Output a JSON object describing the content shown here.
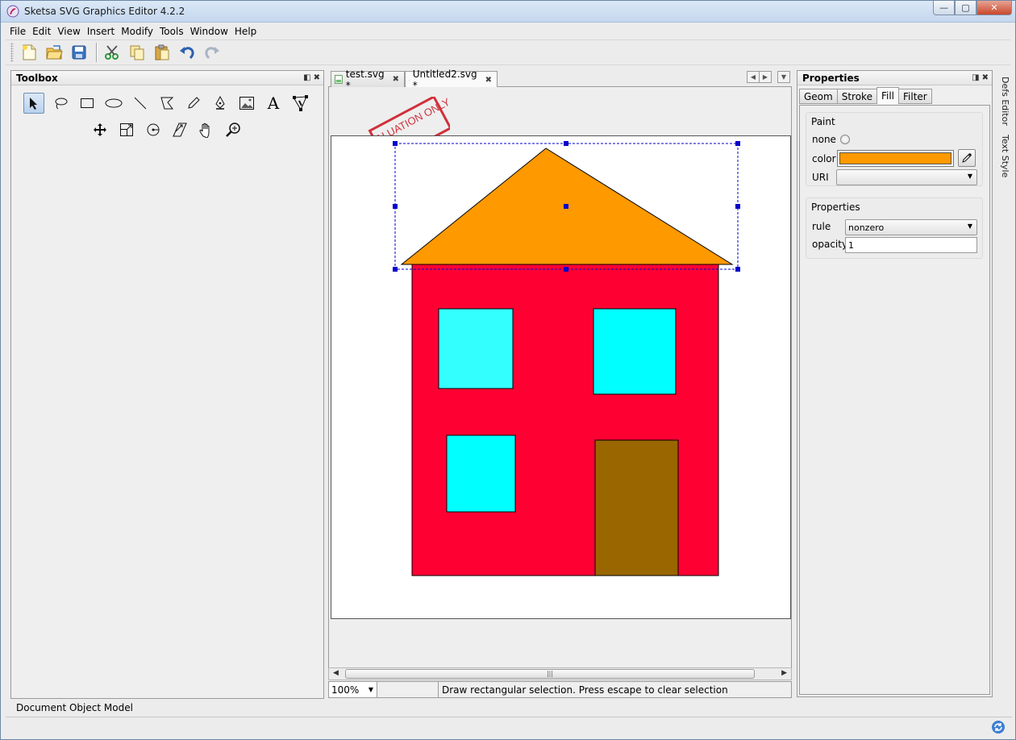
{
  "window": {
    "title": "Sketsa SVG Graphics Editor 4.2.2",
    "controls": {
      "minimize": "—",
      "maximize": "▢",
      "close": "✕"
    }
  },
  "menu": [
    "File",
    "Edit",
    "View",
    "Insert",
    "Modify",
    "Tools",
    "Window",
    "Help"
  ],
  "toolbar": {
    "buttons": [
      "new-file-icon",
      "open-folder-icon",
      "save-icon",
      "cut-icon",
      "copy-icon",
      "paste-icon",
      "undo-icon",
      "redo-icon"
    ]
  },
  "toolbox": {
    "title": "Toolbox",
    "tools_row1": [
      "select-arrow-icon",
      "lasso-icon",
      "rectangle-icon",
      "ellipse-icon",
      "line-icon",
      "polygon-icon",
      "pencil-icon",
      "pen-icon",
      "image-icon",
      "text-icon",
      "node-edit-icon"
    ],
    "tools_row2": [
      "move-icon",
      "scale-icon",
      "rotate-icon",
      "skew-icon",
      "hand-pan-icon",
      "zoom-icon"
    ]
  },
  "editor": {
    "tabs": [
      {
        "label": "test.svg *",
        "active": false
      },
      {
        "label": "Untitled2.svg *",
        "active": true
      }
    ],
    "watermark": "EVALUATION ONLY",
    "zoom": "100%",
    "status_message": "Draw rectangular selection. Press escape to clear selection",
    "drawing": {
      "roof_color": "#ff9900",
      "wall_color": "#ff0033",
      "window_color": "#00ffff",
      "window_color_alt": "#33ffff",
      "door_color": "#996600",
      "selection_color": "#0000cc"
    }
  },
  "properties": {
    "title": "Properties",
    "tabs": [
      "Geom",
      "Stroke",
      "Fill",
      "Filter"
    ],
    "active_tab": "Fill",
    "paint": {
      "title": "Paint",
      "none_label": "none",
      "color_label": "color",
      "color_value": "#ff9900",
      "uri_label": "URI",
      "uri_value": ""
    },
    "props": {
      "title": "Properties",
      "rule_label": "rule",
      "rule_value": "nonzero",
      "opacity_label": "opacity",
      "opacity_value": "1"
    }
  },
  "side_tabs": [
    "Defs Editor",
    "Text Style"
  ],
  "footer": {
    "dom_label": "Document Object Model"
  }
}
